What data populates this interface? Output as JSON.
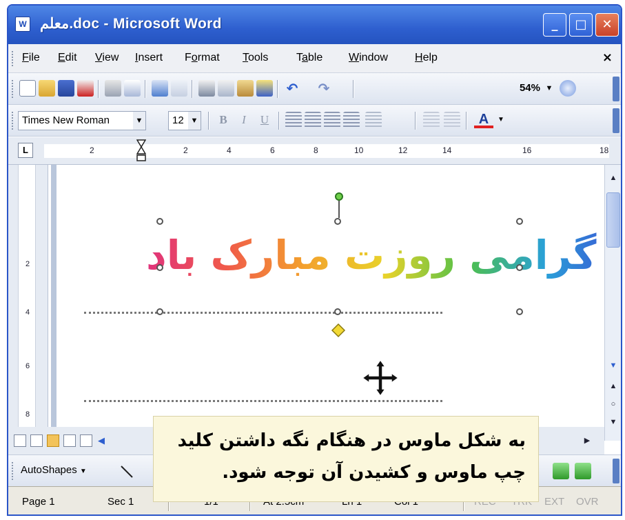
{
  "window": {
    "title": "معلم.doc - Microsoft Word",
    "doc_icon": "W",
    "caption_buttons": {
      "minimize": "_",
      "maximize": "□",
      "close": "✕"
    }
  },
  "menubar": {
    "items": [
      {
        "pre": "",
        "accel": "F",
        "post": "ile"
      },
      {
        "pre": "",
        "accel": "E",
        "post": "dit"
      },
      {
        "pre": "",
        "accel": "V",
        "post": "iew"
      },
      {
        "pre": "",
        "accel": "I",
        "post": "nsert"
      },
      {
        "pre": "F",
        "accel": "o",
        "post": "rmat"
      },
      {
        "pre": "",
        "accel": "T",
        "post": "ools"
      },
      {
        "pre": "T",
        "accel": "a",
        "post": "ble"
      },
      {
        "pre": "",
        "accel": "W",
        "post": "indow"
      },
      {
        "pre": "",
        "accel": "H",
        "post": "elp"
      }
    ],
    "close_glyph": "×"
  },
  "standard_toolbar": {
    "zoom": "54%",
    "icons": [
      "new-icon",
      "open-icon",
      "save-icon",
      "permission-icon",
      "print-icon",
      "print-preview-icon",
      "spelling-icon",
      "research-icon",
      "cut-icon",
      "copy-icon",
      "paste-icon",
      "format-painter-icon",
      "undo-icon",
      "redo-icon",
      "help-icon"
    ],
    "undo_glyph": "↶",
    "redo_glyph": "↷"
  },
  "formatting_toolbar": {
    "font": "Times New Roman",
    "size": "12",
    "bold": "B",
    "italic": "I",
    "underline": "U",
    "font_color_glyph": "A"
  },
  "ruler": {
    "corner": "L",
    "ticks": [
      "2",
      "2",
      "4",
      "6",
      "8",
      "10",
      "12",
      "14",
      "16",
      "18"
    ]
  },
  "vertical_ruler": {
    "ticks": [
      "2",
      "4",
      "6",
      "8"
    ]
  },
  "document": {
    "wordart": "معلم گرامی روزت مبارک باد"
  },
  "draw_toolbar": {
    "autoshapes": "AutoShapes"
  },
  "callout": {
    "line1": "به شکل ماوس در هنگام نگه داشتن کلید",
    "line2": "چپ ماوس و کشیدن آن توجه شود."
  },
  "statusbar": {
    "page": "Page 1",
    "sec": "Sec 1",
    "pages": "1/1",
    "at": "At 2.5cm",
    "ln": "Ln 1",
    "col": "Col 1",
    "rec": "REC",
    "trk": "TRK",
    "ext": "EXT",
    "ovr": "OVR"
  },
  "colors": {
    "title_bar": "#2e5fcf",
    "callout_bg": "#fbf7dc",
    "wordart_gradient": [
      "#e0337c",
      "#f05a4a",
      "#f3a22d",
      "#e8d22a",
      "#4fc04a",
      "#2aa0d8",
      "#3c4fd4",
      "#5a2db3"
    ]
  }
}
